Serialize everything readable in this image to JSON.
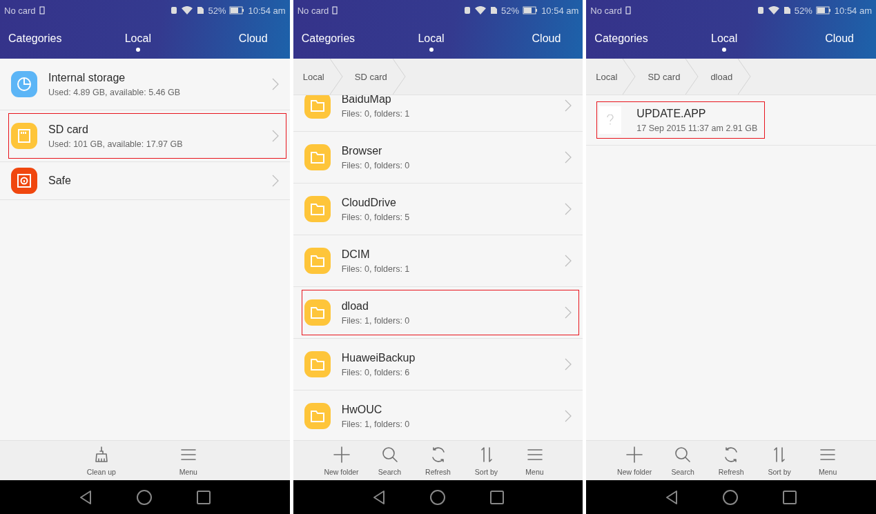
{
  "screens": [
    {
      "status_bar": {
        "carrier": "No card",
        "battery": "52%",
        "time": "10:54 am"
      },
      "tabs": [
        {
          "label": "Categories",
          "selected": false
        },
        {
          "label": "Local",
          "selected": true
        },
        {
          "label": "Cloud",
          "selected": false
        }
      ],
      "items": [
        {
          "kind": "storage",
          "title": "Internal storage",
          "subtitle": "Used: 4.89 GB, available: 5.46 GB",
          "highlighted": false
        },
        {
          "kind": "sdcard",
          "title": "SD card",
          "subtitle": "Used: 101 GB, available: 17.97 GB",
          "highlighted": true
        },
        {
          "kind": "safe",
          "title": "Safe",
          "highlighted": false
        }
      ],
      "toolbar": [
        {
          "kind": "cleanup",
          "label": "Clean up"
        },
        {
          "kind": "menu",
          "label": "Menu"
        }
      ]
    },
    {
      "status_bar": {
        "carrier": "No card",
        "battery": "52%",
        "time": "10:54 am"
      },
      "tabs": [
        {
          "label": "Categories",
          "selected": false
        },
        {
          "label": "Local",
          "selected": true
        },
        {
          "label": "Cloud",
          "selected": false
        }
      ],
      "breadcrumb": [
        "Local",
        "SD card"
      ],
      "items": [
        {
          "kind": "folder",
          "title": "BaiduMap",
          "subtitle": "Files: 0, folders: 1",
          "highlighted": false
        },
        {
          "kind": "folder",
          "title": "Browser",
          "subtitle": "Files: 0, folders: 0",
          "highlighted": false
        },
        {
          "kind": "folder",
          "title": "CloudDrive",
          "subtitle": "Files: 0, folders: 5",
          "highlighted": false
        },
        {
          "kind": "folder",
          "title": "DCIM",
          "subtitle": "Files: 0, folders: 1",
          "highlighted": false
        },
        {
          "kind": "folder",
          "title": "dload",
          "subtitle": "Files: 1, folders: 0",
          "highlighted": true
        },
        {
          "kind": "folder",
          "title": "HuaweiBackup",
          "subtitle": "Files: 0, folders: 6",
          "highlighted": false
        },
        {
          "kind": "folder",
          "title": "HwOUC",
          "subtitle": "Files: 1, folders: 0",
          "highlighted": false
        }
      ],
      "toolbar": [
        {
          "kind": "add",
          "label": "New folder"
        },
        {
          "kind": "search",
          "label": "Search"
        },
        {
          "kind": "refresh",
          "label": "Refresh"
        },
        {
          "kind": "sort",
          "label": "Sort by"
        },
        {
          "kind": "menu",
          "label": "Menu"
        }
      ]
    },
    {
      "status_bar": {
        "carrier": "No card",
        "battery": "52%",
        "time": "10:54 am"
      },
      "tabs": [
        {
          "label": "Categories",
          "selected": false
        },
        {
          "label": "Local",
          "selected": true
        },
        {
          "label": "Cloud",
          "selected": false
        }
      ],
      "breadcrumb": [
        "Local",
        "SD card",
        "dload"
      ],
      "items": [
        {
          "kind": "file",
          "title": "UPDATE.APP",
          "subtitle": "17 Sep 2015 11:37 am 2.91 GB",
          "highlighted": true
        }
      ],
      "toolbar": [
        {
          "kind": "add",
          "label": "New folder"
        },
        {
          "kind": "search",
          "label": "Search"
        },
        {
          "kind": "refresh",
          "label": "Refresh"
        },
        {
          "kind": "sort",
          "label": "Sort by"
        },
        {
          "kind": "menu",
          "label": "Menu"
        }
      ]
    }
  ]
}
